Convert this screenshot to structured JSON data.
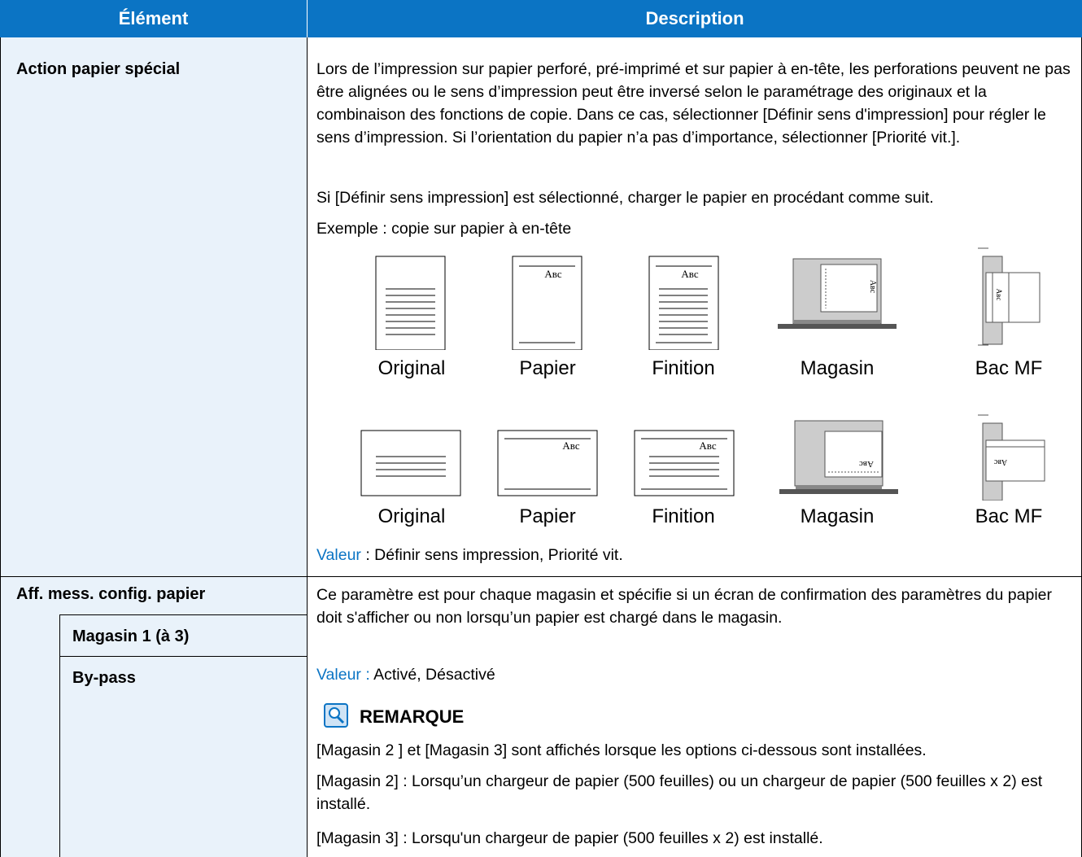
{
  "header": {
    "col1": "Élément",
    "col2": "Description"
  },
  "row1": {
    "label": "Action papier spécial",
    "para1": "Lors de l’impression sur papier perforé, pré-imprimé et sur papier à en-tête, les perforations peuvent ne pas être alignées ou le sens d’impression peut être inversé selon le paramétrage des originaux et la combinaison des fonctions de copie. Dans ce cas, sélectionner [Définir sens d'impression] pour régler le sens d’impression. Si l’orientation du papier n’a pas d’importance, sélectionner [Priorité vit.].",
    "para2": "Si [Définir sens impression] est sélectionné, charger le papier en procédant comme suit.",
    "example": "Exemple : copie sur papier à en-tête",
    "captions": [
      "Original",
      "Papier",
      "Finition",
      "Magasin",
      "Bac MF"
    ],
    "paper_text": "ABC",
    "value_label": "Valeur",
    "value_text": " : Définir sens impression, Priorité vit."
  },
  "row2": {
    "label": "Aff. mess. config. papier",
    "sub1": "Magasin 1 (à 3)",
    "sub2": "By-pass",
    "para1": "Ce paramètre est pour chaque magasin et spécifie si un écran de confirmation des paramètres du papier doit s'afficher ou non lorsqu’un papier est chargé dans le magasin.",
    "value_label": "Valeur :",
    "value_text": " Activé, Désactivé",
    "note_title": "REMARQUE",
    "note1": "[Magasin 2 ] et [Magasin 3] sont affichés lorsque les options ci-dessous sont installées.",
    "note2": "[Magasin 2] : Lorsqu’un chargeur de papier (500 feuilles) ou un chargeur de papier (500 feuilles x 2) est installé.",
    "note3": "[Magasin 3] : Lorsqu'un chargeur de papier (500 feuilles x 2) est installé."
  },
  "colors": {
    "header_bg": "#0b74c4",
    "label_bg": "#e9f2fa",
    "accent": "#0b74c4"
  },
  "icons": {
    "note": "magnifier-note-icon"
  }
}
